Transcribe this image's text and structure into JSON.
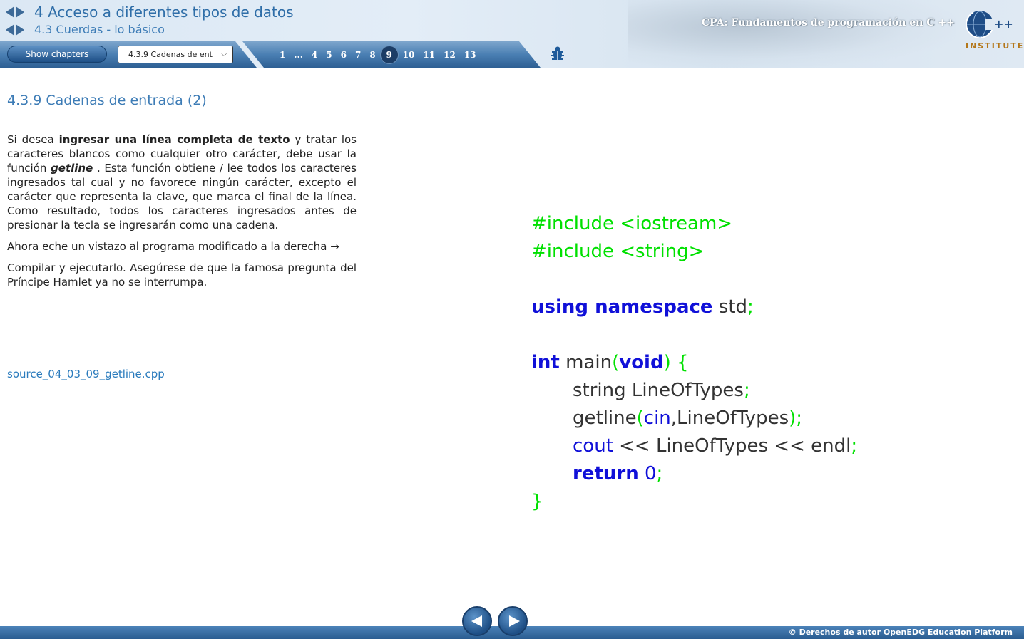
{
  "header": {
    "chapter_title": "4 Acceso a diferentes tipos de datos",
    "section_title": "4.3 Cuerdas - lo básico",
    "course_title": "CPA: Fundamentos de programación en C ++",
    "logo_text": "INSTITUTE"
  },
  "toolbar": {
    "show_chapters_label": "Show chapters",
    "page_select_value": "4.3.9 Cadenas de ent",
    "pages": [
      "1",
      "...",
      "4",
      "5",
      "6",
      "7",
      "8",
      "9",
      "10",
      "11",
      "12",
      "13"
    ],
    "active_page": "9"
  },
  "content": {
    "heading": "4.3.9 Cadenas de entrada (2)",
    "para1_a": "Si desea ",
    "para1_bold": "ingresar una línea completa de texto",
    "para1_b": " y tratar los caracteres blancos como cualquier otro carácter, debe usar la función ",
    "para1_func": "getline",
    "para1_c": " . Esta función obtiene / lee todos los caracteres ingresados tal cual y no favorece ningún carácter, excepto el carácter que representa la clave, que marca el final de la línea. Como resultado, todos los caracteres ingresados antes de presionar la tecla se ingresarán como una cadena.",
    "para2": "Ahora eche un vistazo al programa modificado a la derecha →",
    "para3": "Compilar y ejecutarlo. Asegúrese de que la famosa pregunta del Príncipe Hamlet ya no se interrumpa.",
    "source_link": "source_04_03_09_getline.cpp"
  },
  "code": {
    "include1": "#include <iostream>",
    "include2": "#include <string>",
    "kw_using": "using namespace",
    "std": " std",
    "semi": ";",
    "kw_int": "int",
    "main": " main",
    "paren_open": "(",
    "kw_void": "void",
    "paren_close_brace": ") {",
    "decl": "string LineOfTypes",
    "getline": "getline",
    "cin": "cin",
    "getline_arg2": ",LineOfTypes",
    "close_paren_semi": ");",
    "cout": "cout",
    "cout_rest": " << LineOfTypes << endl",
    "kw_return": "return",
    "zero": " 0",
    "close_brace": "}"
  },
  "footer": {
    "copyright": "© Derechos de autor OpenEDG Education Platform"
  },
  "colors": {
    "accent": "#3d7cb6",
    "code_green": "#00e000",
    "code_blue": "#1010d8"
  }
}
